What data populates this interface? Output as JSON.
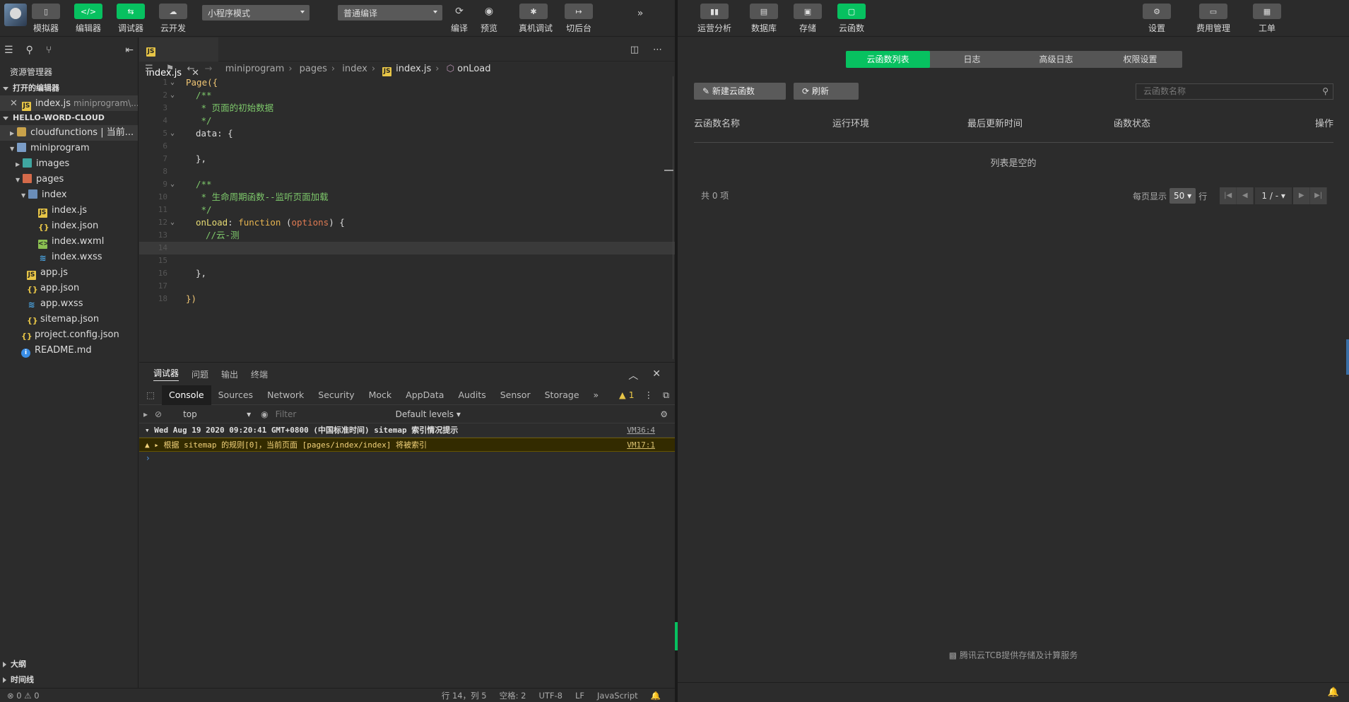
{
  "ide": {
    "toolbar": {
      "simulator": "模拟器",
      "editor": "编辑器",
      "debugger": "调试器",
      "cloud_dev": "云开发",
      "mode_select": "小程序模式",
      "compile_select": "普通编译",
      "compile": "编译",
      "preview": "预览",
      "real_debug": "真机调试",
      "backend": "切后台"
    },
    "sidebar": {
      "title": "资源管理器",
      "open_editors": "打开的编辑器",
      "open_file": "index.js",
      "open_file_path": "miniprogram\\...",
      "project": "HELLO-WORD-CLOUD",
      "tree": [
        {
          "label": "cloudfunctions | 当前..."
        },
        {
          "label": "miniprogram"
        },
        {
          "label": "images"
        },
        {
          "label": "pages"
        },
        {
          "label": "index"
        },
        {
          "label": "index.js"
        },
        {
          "label": "index.json"
        },
        {
          "label": "index.wxml"
        },
        {
          "label": "index.wxss"
        },
        {
          "label": "app.js"
        },
        {
          "label": "app.json"
        },
        {
          "label": "app.wxss"
        },
        {
          "label": "sitemap.json"
        },
        {
          "label": "project.config.json"
        },
        {
          "label": "README.md"
        }
      ],
      "outline": "大纲",
      "timeline": "时间线"
    },
    "tab": {
      "label": "index.js"
    },
    "breadcrumb": [
      "miniprogram",
      "pages",
      "index",
      "index.js",
      "onLoad"
    ],
    "code": {
      "l1": "Page({",
      "l2": "/**",
      "l3": " * 页面的初始数据",
      "l4": " */",
      "l5_key": "data",
      "l5_rest": ": {",
      "l7": "},",
      "l9": "/**",
      "l10": " * 生命周期函数--监听页面加载",
      "l11": " */",
      "l12_key": "onLoad",
      "l12_fn": "function",
      "l12_param": "options",
      "l13": "//云-测",
      "l16": "},",
      "l18": "})"
    },
    "debugger": {
      "tabs": [
        "调试器",
        "问题",
        "输出",
        "终端"
      ],
      "devtools_tabs": [
        "Console",
        "Sources",
        "Network",
        "Security",
        "Mock",
        "AppData",
        "Audits",
        "Sensor",
        "Storage"
      ],
      "warn_count": "1",
      "context": "top",
      "filter_placeholder": "Filter",
      "levels": "Default levels",
      "log_group": "Wed Aug 19 2020 09:20:41 GMT+0800 (中国标准时间) sitemap 索引情况提示",
      "log_group_src": "VM36:4",
      "log_warn": "根据 sitemap 的规则[0]，当前页面 [pages/index/index] 将被索引",
      "log_warn_src": "VM17:1"
    },
    "status": {
      "problems": "⊗ 0 ⚠ 0",
      "position": "行 14，列 5",
      "spaces": "空格: 2",
      "encoding": "UTF-8",
      "eol": "LF",
      "language": "JavaScript"
    }
  },
  "cloud": {
    "toolbar": {
      "analytics": "运营分析",
      "database": "数据库",
      "storage": "存储",
      "functions": "云函数",
      "settings": "设置",
      "billing": "费用管理",
      "ticket": "工单"
    },
    "segments": [
      "云函数列表",
      "日志",
      "高级日志",
      "权限设置"
    ],
    "new_function": "新建云函数",
    "refresh": "刷新",
    "search_placeholder": "云函数名称",
    "columns": [
      "云函数名称",
      "运行环境",
      "最后更新时间",
      "函数状态",
      "操作"
    ],
    "empty": "列表是空的",
    "total": "共 0 项",
    "per_page_label": "每页显示",
    "per_page": "50",
    "per_page_unit": "行",
    "page": "1 / -",
    "footer": "腾讯云TCB提供存储及计算服务"
  }
}
